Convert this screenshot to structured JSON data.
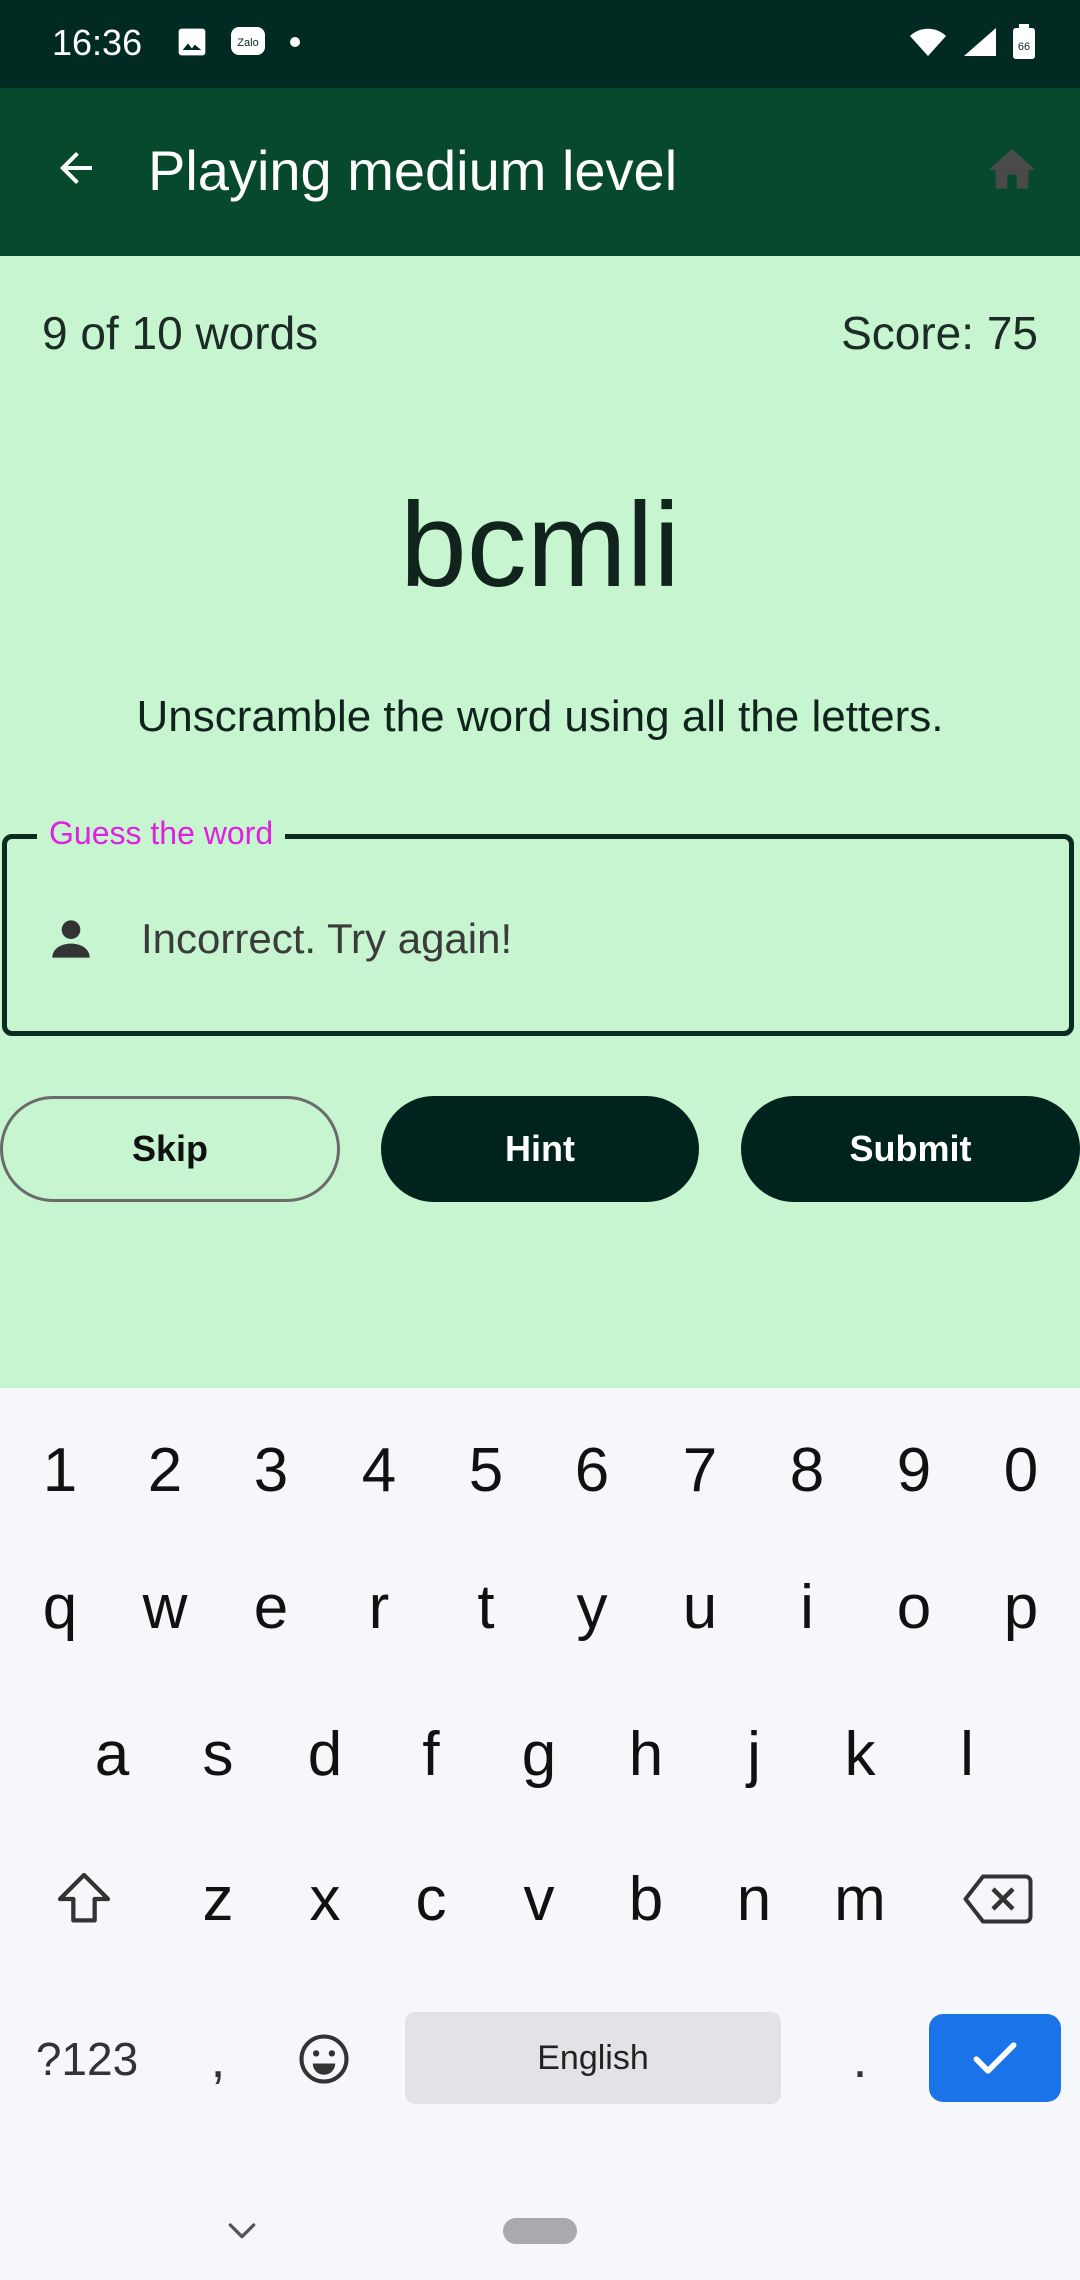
{
  "status": {
    "time": "16:36",
    "battery": "66"
  },
  "appbar": {
    "title": "Playing medium level"
  },
  "game": {
    "word_count": "9 of 10 words",
    "score": "Score: 75",
    "scrambled_word": "bcmli",
    "instructions": "Unscramble the word using all the letters.",
    "field_label": "Guess the word",
    "field_value": "Incorrect. Try again!"
  },
  "buttons": {
    "skip": "Skip",
    "hint": "Hint",
    "submit": "Submit"
  },
  "keyboard": {
    "row1": [
      "1",
      "2",
      "3",
      "4",
      "5",
      "6",
      "7",
      "8",
      "9",
      "0"
    ],
    "row2": [
      "q",
      "w",
      "e",
      "r",
      "t",
      "y",
      "u",
      "i",
      "o",
      "p"
    ],
    "row3": [
      "a",
      "s",
      "d",
      "f",
      "g",
      "h",
      "j",
      "k",
      "l"
    ],
    "row4": [
      "z",
      "x",
      "c",
      "v",
      "b",
      "n",
      "m"
    ],
    "symbols_key": "?123",
    "comma": ",",
    "period": ".",
    "space_label": "English"
  },
  "colors": {
    "accent": "#06492d",
    "background": "#c6f5d0",
    "label": "#e020e0",
    "enter": "#1a73e8"
  }
}
